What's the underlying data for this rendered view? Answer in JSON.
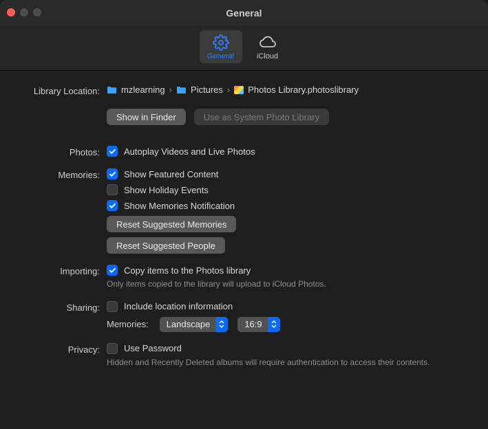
{
  "window": {
    "title": "General"
  },
  "tabs": {
    "general": "General",
    "icloud": "iCloud"
  },
  "libraryLocation": {
    "label": "Library Location:",
    "segments": [
      "mzlearning",
      "Pictures",
      "Photos Library.photoslibrary"
    ],
    "showInFinder": "Show in Finder",
    "useAsSystem": "Use as System Photo Library"
  },
  "photos": {
    "label": "Photos:",
    "autoplay": "Autoplay Videos and Live Photos"
  },
  "memories": {
    "label": "Memories:",
    "showFeatured": "Show Featured Content",
    "showHoliday": "Show Holiday Events",
    "showNotif": "Show Memories Notification",
    "resetMemories": "Reset Suggested Memories",
    "resetPeople": "Reset Suggested People"
  },
  "importing": {
    "label": "Importing:",
    "copy": "Copy items to the Photos library",
    "sub": "Only items copied to the library will upload to iCloud Photos."
  },
  "sharing": {
    "label": "Sharing:",
    "includeLocation": "Include location information",
    "memoriesLabel": "Memories:",
    "orientation": "Landscape",
    "aspect": "16:9"
  },
  "privacy": {
    "label": "Privacy:",
    "usePassword": "Use Password",
    "sub": "Hidden and Recently Deleted albums will require authentication to access their contents."
  }
}
